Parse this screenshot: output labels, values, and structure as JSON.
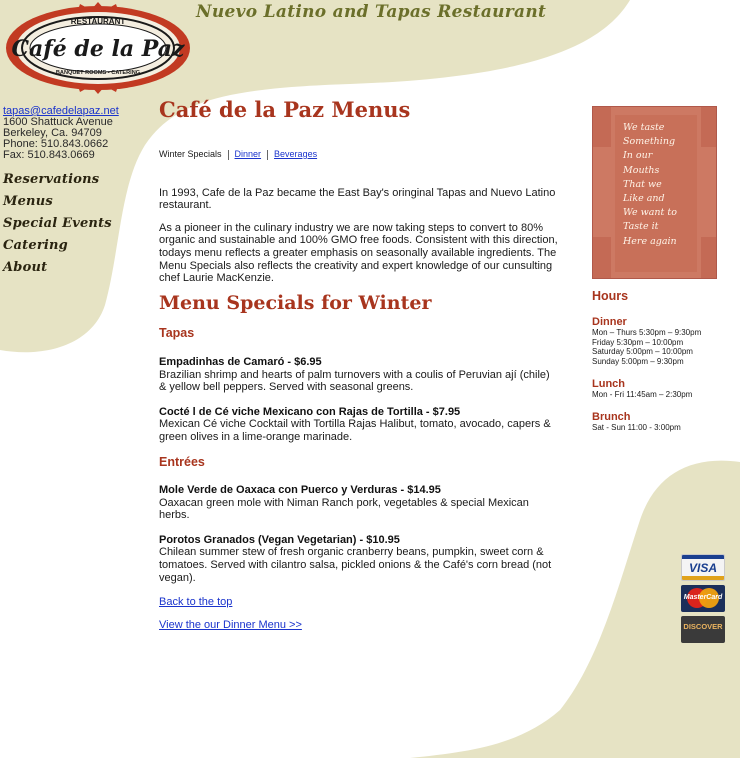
{
  "header": {
    "logo": {
      "restaurant_text": "RESTAURANT",
      "brand_text": "Café de la Paz",
      "subtitle_text": "BANQUET ROOMS • CATERING"
    },
    "tagline": "Nuevo Latino and Tapas Restaurant"
  },
  "contact": {
    "email": "tapas@cafedelapaz.net",
    "address": "1600 Shattuck Avenue",
    "city": "Berkeley, Ca. 94709",
    "phone": "Phone: 510.843.0662",
    "fax": "Fax: 510.843.0669"
  },
  "nav": {
    "items": [
      {
        "label": "Reservations"
      },
      {
        "label": "Menus"
      },
      {
        "label": "Special Events"
      },
      {
        "label": "Catering"
      },
      {
        "label": "About"
      }
    ]
  },
  "main": {
    "title": "Café de la Paz Menus",
    "submenu": {
      "current": "Winter Specials",
      "links": [
        "Dinner",
        "Beverages"
      ]
    },
    "intro": [
      "In 1993, Cafe de la Paz became the East Bay's oringinal Tapas and Nuevo Latino restaurant.",
      "As a pioneer in the culinary industry we are now taking steps to convert to 80% organic and sustainable and 100% GMO free foods. Consistent with this direction, todays menu reflects a greater emphasis on seasonally available ingredients. The Menu Specials also reflects the creativity and expert knowledge of our cunsulting chef Laurie MacKenzie."
    ],
    "specials_title": "Menu Specials for Winter",
    "categories": [
      {
        "title": "Tapas",
        "items": [
          {
            "name": "Empadinhas de Camaró - $6.95",
            "desc": "Brazilian shrimp and hearts of palm turnovers with a coulis of Peruvian ají (chile) & yellow bell peppers. Served with seasonal greens."
          },
          {
            "name": "Cocté l de Cé viche Mexicano con Rajas de Tortilla - $7.95",
            "desc": "Mexican Cé viche Cocktail with Tortilla Rajas Halibut, tomato, avocado, capers & green olives in a lime-orange marinade."
          }
        ]
      },
      {
        "title": "Entrées",
        "items": [
          {
            "name": "Mole Verde de Oaxaca con Puerco y Verduras - $14.95",
            "desc": "Oaxacan green mole with Niman Ranch pork, vegetables & special Mexican herbs."
          },
          {
            "name": "Porotos Granados (Vegan Vegetarian) - $10.95",
            "desc": "Chilean summer stew of fresh organic cranberry beans, pumpkin, sweet corn & tomatoes. Served with cilantro salsa, pickled onions & the Café's corn bread (not vegan)."
          }
        ]
      }
    ],
    "back_to_top": "Back to the top",
    "view_dinner": "View the our Dinner Menu >>"
  },
  "poem": {
    "lines": [
      "We taste",
      "Something",
      "In our",
      "Mouths",
      "That we",
      "Like and",
      "We want to",
      "Taste it",
      "Here again"
    ]
  },
  "hours": {
    "title": "Hours",
    "meals": [
      {
        "name": "Dinner",
        "lines": [
          "Mon – Thurs 5:30pm – 9:30pm",
          "Friday 5:30pm – 10:00pm",
          "Saturday 5:00pm – 10:00pm",
          "Sunday 5:00pm – 9:30pm"
        ]
      },
      {
        "name": "Lunch",
        "lines": [
          "Mon - Fri 11:45am – 2:30pm"
        ]
      },
      {
        "name": "Brunch",
        "lines": [
          "Sat - Sun 11:00 - 3:00pm"
        ]
      }
    ]
  },
  "cards": {
    "visa": "VISA",
    "mastercard": "MasterCard",
    "discover": "DISCOVER"
  },
  "colors": {
    "accent": "#a8351e",
    "swoosh": "#e6e3c4",
    "link": "#1a33cc",
    "poem_bg": "#c46a55"
  }
}
